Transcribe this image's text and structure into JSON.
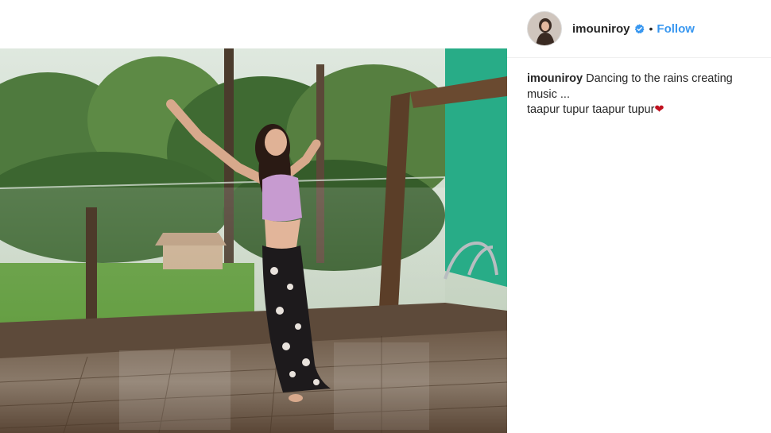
{
  "post": {
    "image_alt": "Woman dancing on a rain-soaked balcony deck surrounded by trees",
    "username": "imouniroy",
    "verified_icon": "verified-badge-icon",
    "separator": "•",
    "follow_label": "Follow",
    "caption_user": "imouniroy",
    "caption_text": "Dancing to the rains creating music ...",
    "caption_line2": "taapur tupur taapur tupur",
    "caption_emoji": "❤"
  },
  "colors": {
    "follow": "#3897f0",
    "heart": "#c0111f",
    "verified": "#3897f0"
  }
}
